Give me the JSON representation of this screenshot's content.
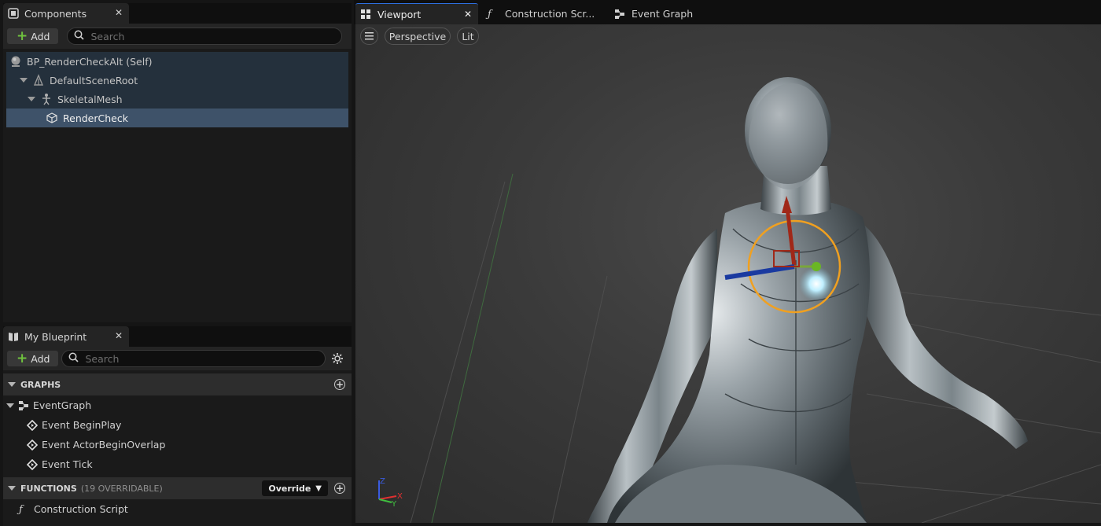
{
  "components_panel": {
    "tab_label": "Components",
    "add_label": "Add",
    "search_placeholder": "Search",
    "tree": [
      {
        "label": "BP_RenderCheckAlt (Self)",
        "icon": "actor-sphere-icon"
      },
      {
        "label": "DefaultSceneRoot",
        "icon": "scene-root-icon"
      },
      {
        "label": "SkeletalMesh",
        "icon": "skeleton-icon"
      },
      {
        "label": "RenderCheck",
        "icon": "static-mesh-cube-icon",
        "selected": true
      }
    ]
  },
  "my_blueprint_panel": {
    "tab_label": "My Blueprint",
    "add_label": "Add",
    "search_placeholder": "Search",
    "graphs_header": "GRAPHS",
    "event_graph_label": "EventGraph",
    "events": [
      "Event BeginPlay",
      "Event ActorBeginOverlap",
      "Event Tick"
    ],
    "functions_header": "FUNCTIONS",
    "functions_sub": "(19 OVERRIDABLE)",
    "override_label": "Override",
    "construction_script_label": "Construction Script"
  },
  "editor_tabs": [
    {
      "label": "Viewport",
      "icon": "viewport-grid-icon",
      "active": true
    },
    {
      "label": "Construction Scr...",
      "icon": "function-icon"
    },
    {
      "label": "Event Graph",
      "icon": "graph-nodes-icon"
    }
  ],
  "viewport": {
    "menu_icon": "hamburger-icon",
    "perspective_label": "Perspective",
    "lit_label": "Lit",
    "axis_z": "Z",
    "axis_x": "X",
    "axis_y": "Y"
  },
  "colors": {
    "accent_blue": "#2e6fe0",
    "add_green": "#6fc23e",
    "selection": "#3e5269",
    "tree_row": "#24303c",
    "gizmo_orange": "#f0a020"
  }
}
